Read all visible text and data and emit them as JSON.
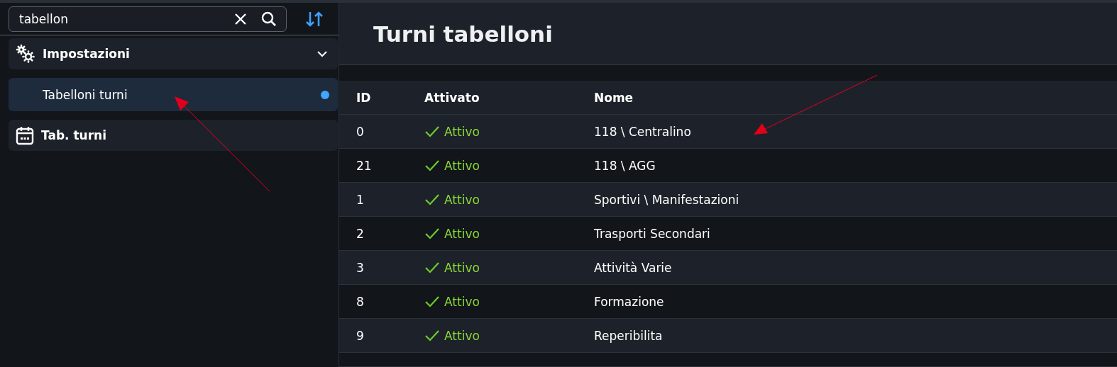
{
  "sidebar": {
    "search": {
      "value": "tabellon"
    },
    "items": [
      {
        "label": "Impostazioni",
        "kind": "group",
        "expanded": true,
        "children": [
          {
            "label": "Tabelloni turni",
            "selected": true,
            "unread": true
          }
        ]
      },
      {
        "label": "Tab. turni",
        "kind": "link"
      }
    ]
  },
  "main": {
    "title": "Turni tabelloni",
    "table": {
      "columns": [
        "ID",
        "Attivato",
        "Nome"
      ],
      "rows": [
        {
          "id": "0",
          "status": "Attivo",
          "active": true,
          "name": "118 \\ Centralino"
        },
        {
          "id": "21",
          "status": "Attivo",
          "active": true,
          "name": "118 \\ AGG"
        },
        {
          "id": "1",
          "status": "Attivo",
          "active": true,
          "name": "Sportivi \\ Manifestazioni"
        },
        {
          "id": "2",
          "status": "Attivo",
          "active": true,
          "name": "Trasporti Secondari"
        },
        {
          "id": "3",
          "status": "Attivo",
          "active": true,
          "name": "Attività Varie"
        },
        {
          "id": "8",
          "status": "Attivo",
          "active": true,
          "name": "Formazione"
        },
        {
          "id": "9",
          "status": "Attivo",
          "active": true,
          "name": "Reperibilita"
        }
      ]
    }
  },
  "annotations": [
    {
      "kind": "arrow"
    },
    {
      "kind": "arrow"
    }
  ]
}
